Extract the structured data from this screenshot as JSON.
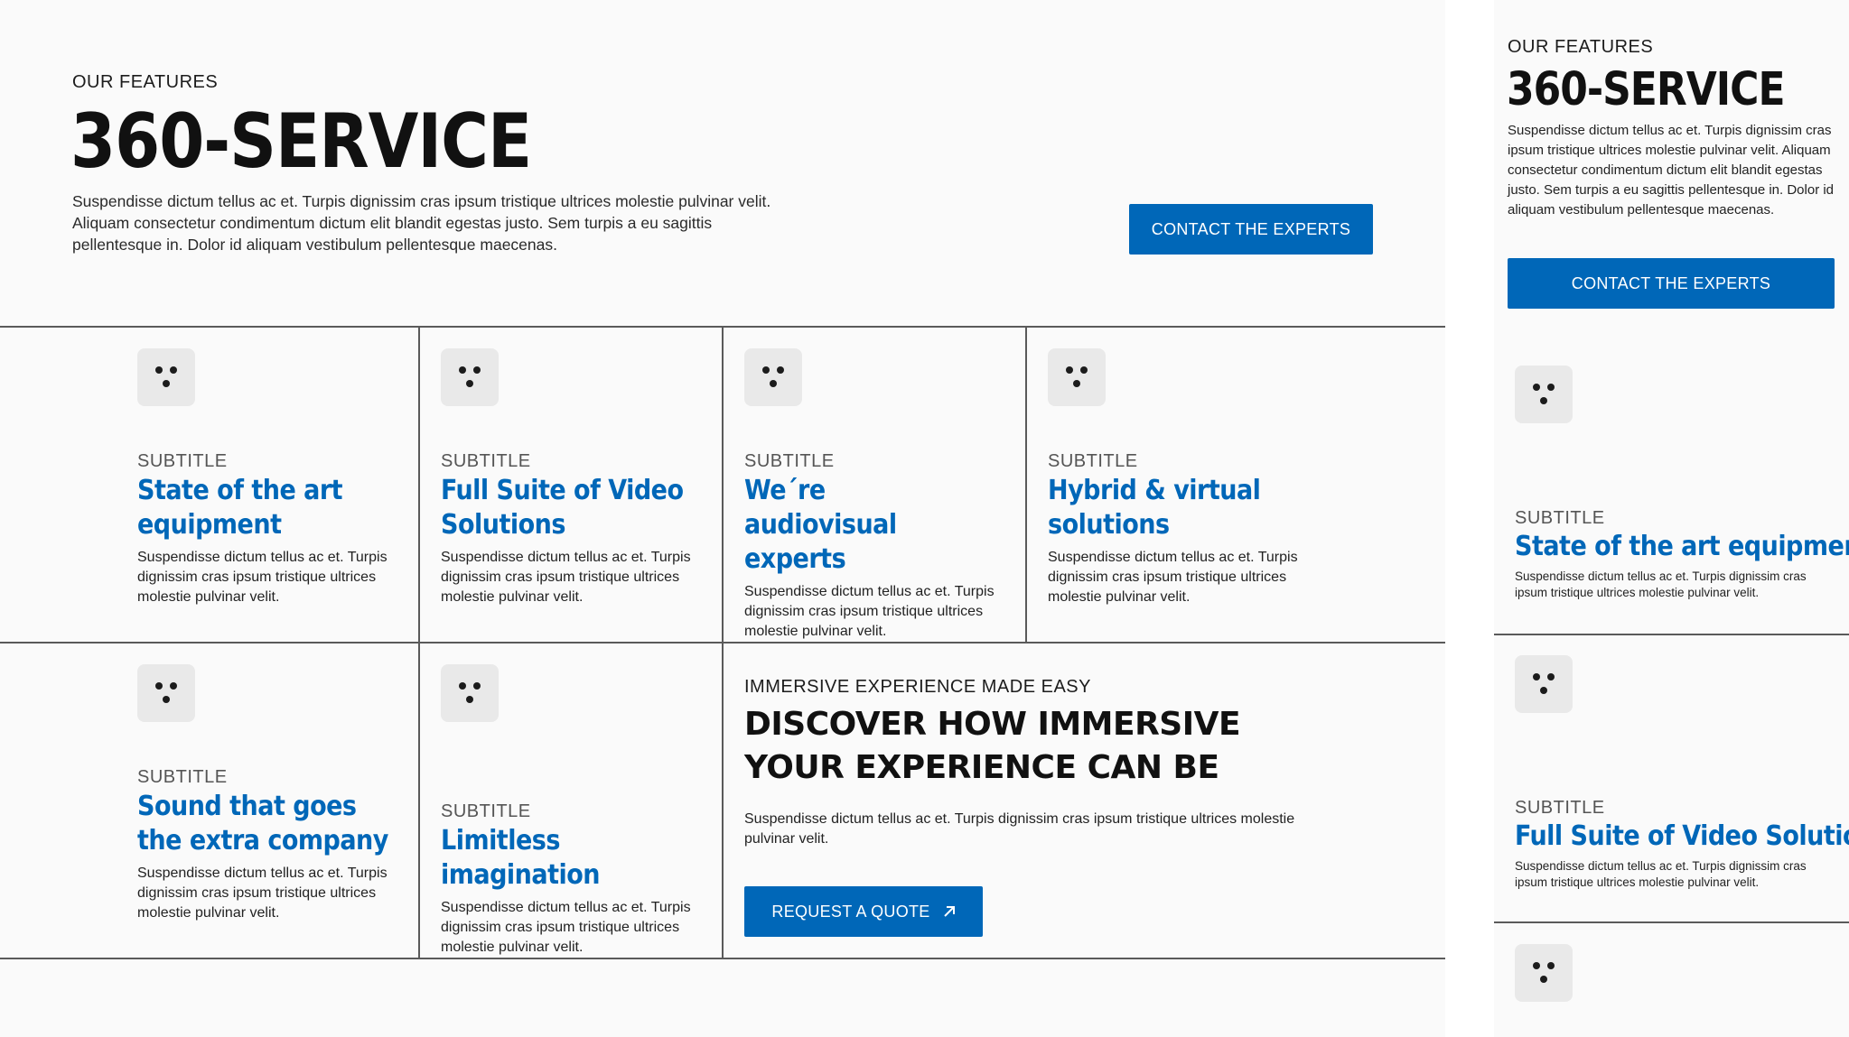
{
  "desktop": {
    "header": {
      "eyebrow": "OUR FEATURES",
      "title": "360-SERVICE",
      "intro": "Suspendisse dictum tellus ac et. Turpis dignissim cras ipsum tristique ultrices molestie pulvinar velit. Aliquam consectetur condimentum dictum elit blandit egestas justo. Sem turpis a eu sagittis pellentesque in. Dolor id aliquam vestibulum pellentesque maecenas.",
      "contact_button": "CONTACT THE EXPERTS"
    },
    "features": [
      {
        "subtitle": "SUBTITLE",
        "title": "State of the art equipment",
        "text": "Suspendisse dictum tellus ac et. Turpis dignissim cras ipsum tristique ultrices molestie pulvinar velit."
      },
      {
        "subtitle": "SUBTITLE",
        "title": "Full Suite of Video Solutions",
        "text": "Suspendisse dictum tellus ac et. Turpis dignissim cras ipsum tristique ultrices molestie pulvinar velit."
      },
      {
        "subtitle": "SUBTITLE",
        "title": "We´re audiovisual experts",
        "text": "Suspendisse dictum tellus ac et. Turpis dignissim cras ipsum tristique ultrices molestie pulvinar velit."
      },
      {
        "subtitle": "SUBTITLE",
        "title": "Hybrid & virtual solutions",
        "text": "Suspendisse dictum tellus ac et. Turpis dignissim cras ipsum tristique ultrices molestie pulvinar velit."
      },
      {
        "subtitle": "SUBTITLE",
        "title": "Sound that goes the extra company",
        "text": "Suspendisse dictum tellus ac et. Turpis dignissim cras ipsum tristique ultrices molestie pulvinar velit."
      },
      {
        "subtitle": "SUBTITLE",
        "title": "Limitless imagination",
        "text": "Suspendisse dictum tellus ac et. Turpis dignissim cras ipsum tristique ultrices molestie pulvinar velit."
      }
    ],
    "cta": {
      "eyebrow": "IMMERSIVE EXPERIENCE MADE EASY",
      "title": "DISCOVER HOW IMMERSIVE YOUR EXPERIENCE CAN BE",
      "text": "Suspendisse dictum tellus ac et. Turpis dignissim cras ipsum tristique ultrices molestie pulvinar velit.",
      "button": "REQUEST A QUOTE",
      "button_icon": "arrow-up-right-icon"
    }
  },
  "mobile": {
    "eyebrow": "OUR FEATURES",
    "title": "360-SERVICE",
    "intro": "Suspendisse dictum tellus ac et. Turpis dignissim cras ipsum tristique ultrices molestie pulvinar velit. Aliquam consectetur condimentum dictum elit blandit egestas justo. Sem turpis a eu sagittis pellentesque in. Dolor id aliquam vestibulum pellentesque maecenas.",
    "contact_button": "CONTACT THE EXPERTS",
    "features": [
      {
        "subtitle": "SUBTITLE",
        "title": "State of the art equipment",
        "text": "Suspendisse dictum tellus ac et. Turpis dignissim cras ipsum tristique ultrices molestie pulvinar velit."
      },
      {
        "subtitle": "SUBTITLE",
        "title": "Full Suite of Video Solutions",
        "text": "Suspendisse dictum tellus ac et. Turpis dignissim cras ipsum tristique ultrices molestie pulvinar velit."
      }
    ]
  },
  "colors": {
    "accent": "#0067b8",
    "background": "#fafafa",
    "icon_tile": "#e9e9e9",
    "text": "#1c1c1c"
  },
  "icons": {
    "feature_icon": "three-dots-face-icon"
  }
}
